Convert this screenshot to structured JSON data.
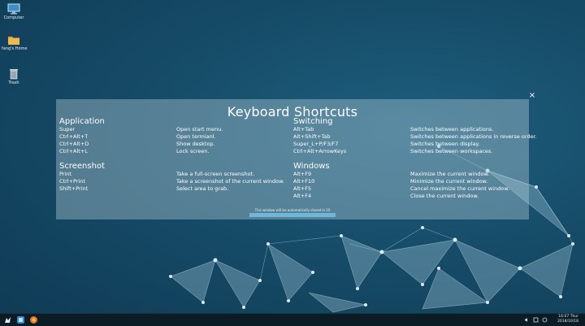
{
  "desktop": {
    "icons": [
      {
        "name": "Computer"
      },
      {
        "name": "fang's Home"
      },
      {
        "name": "Trash"
      }
    ]
  },
  "overlay": {
    "title": "Keyboard Shortcuts",
    "sections": {
      "application": {
        "title": "Application",
        "rows": [
          {
            "key": "Super",
            "desc": "Open start menu."
          },
          {
            "key": "Ctrl+Alt+T",
            "desc": "Open termianl."
          },
          {
            "key": "Ctrl+Alt+D",
            "desc": "Show desktop."
          },
          {
            "key": "Ctrl+Alt+L",
            "desc": "Lock screen."
          }
        ]
      },
      "screenshot": {
        "title": "Screenshot",
        "rows": [
          {
            "key": "Print",
            "desc": "Take a full-screen screenshot."
          },
          {
            "key": "Ctrl+Print",
            "desc": "Take a screenshot of the current window."
          },
          {
            "key": "Shift+Print",
            "desc": "Select area to grab."
          }
        ]
      },
      "switching": {
        "title": "Switching",
        "rows": [
          {
            "key": "Alt+Tab",
            "desc": "Switches between applications."
          },
          {
            "key": "Alt+Shift+Tab",
            "desc": "Switches between applications in reverse order."
          },
          {
            "key": "Super_L+P/F3/F7",
            "desc": "Switches between display."
          },
          {
            "key": "Ctrl+Alt+ArrowKeys",
            "desc": "Switches between workspaces."
          }
        ]
      },
      "windows": {
        "title": "Windows",
        "rows": [
          {
            "key": "Alt+F9",
            "desc": "Maximize the current window."
          },
          {
            "key": "Alt+F10",
            "desc": "Minimize the current window."
          },
          {
            "key": "Alt+F5",
            "desc": "Cancel maximize the current window."
          },
          {
            "key": "Alt+F4",
            "desc": "Close the current window."
          }
        ]
      }
    },
    "close_label": "×",
    "notice": "This window will be automatically closed in 10 seconds",
    "progress": 1.0
  },
  "taskbar": {
    "icons": [
      "launcher-icon",
      "file-manager-icon",
      "browser-icon"
    ],
    "clock_time": "16:07 Thur",
    "clock_date": "2018/10/18"
  },
  "colors": {
    "accent": "#6fb7d6",
    "taskbar": "#0c1c26"
  }
}
